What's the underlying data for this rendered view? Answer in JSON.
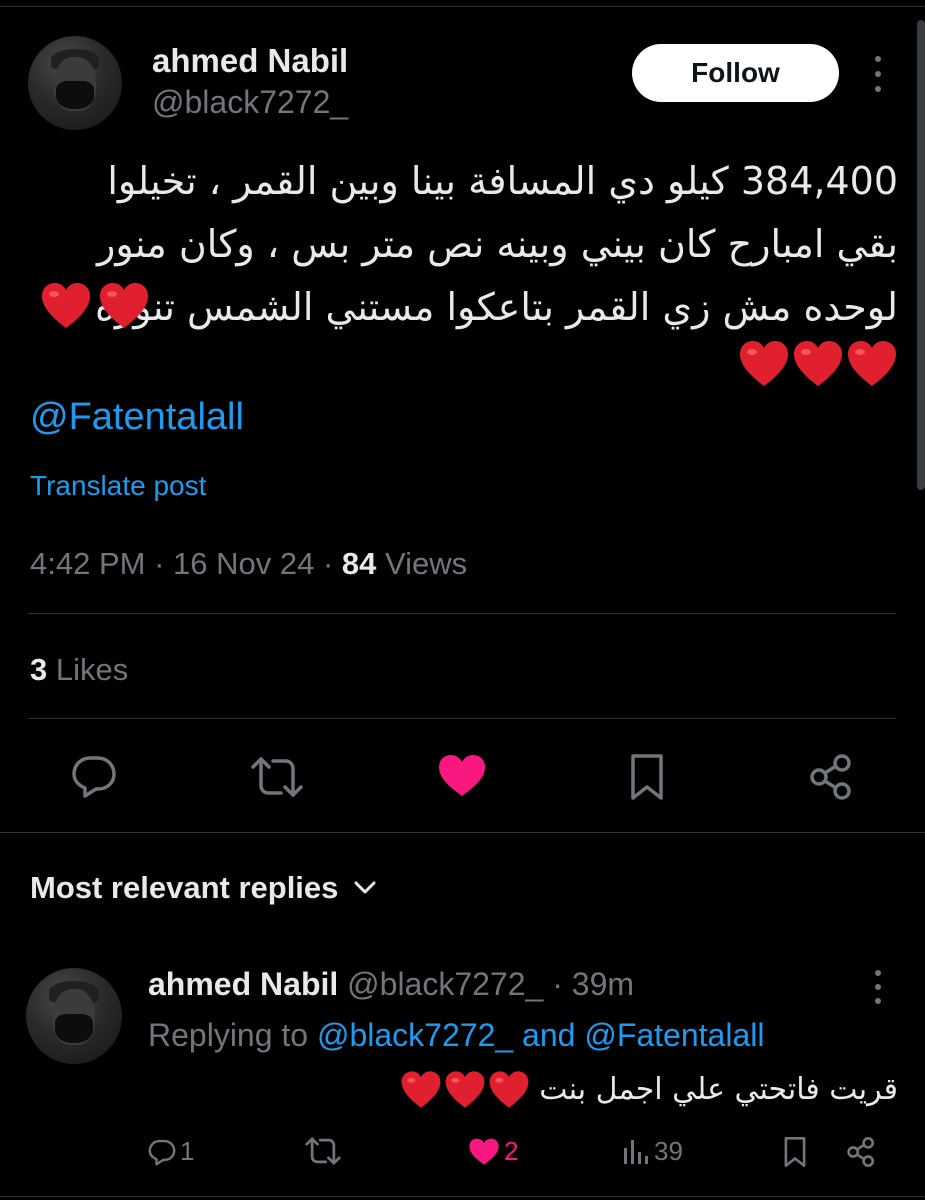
{
  "post": {
    "author_name": "ahmed Nabil",
    "author_handle": "@black7272_",
    "follow_label": "Follow",
    "text_lines": [
      "384,400 كيلو   دي المسافة بينا وبين القمر ، تخيلوا",
      "بقي امبارح كان بيني وبينه نص متر بس  ، وكان منور",
      "لوحده مش زي القمر بتاعكوا مستني الشمس تنوره"
    ],
    "mention": "@Fatentalall",
    "translate_label": "Translate post",
    "time": "4:42 PM",
    "date": "16 Nov 24",
    "views_count": "84",
    "views_label": "Views",
    "likes_count": "3",
    "likes_label": "Likes"
  },
  "icons": {
    "reply": "comment-bubble-icon",
    "repost": "repost-arrows-icon",
    "like": "heart-filled-icon",
    "bookmark": "bookmark-icon",
    "share": "share-nodes-icon",
    "more": "more-vertical-icon",
    "views": "bar-chart-icon",
    "chevron": "chevron-down-icon"
  },
  "colors": {
    "accent": "#1d9bf0",
    "like": "#f91880",
    "muted": "#71767b",
    "heart_emoji": "#e0202e"
  },
  "replies_section": {
    "header": "Most relevant replies"
  },
  "reply": {
    "author_name": "ahmed Nabil",
    "author_handle": "@black7272_",
    "time": "· 39m",
    "replying_prefix": "Replying to",
    "replying_user1": "@black7272_",
    "replying_and": "and",
    "replying_user2": "@Fatentalall",
    "text": "قريت فاتحتي علي اجمل بنت",
    "reply_count": "1",
    "like_count": "2",
    "views_count": "39"
  }
}
